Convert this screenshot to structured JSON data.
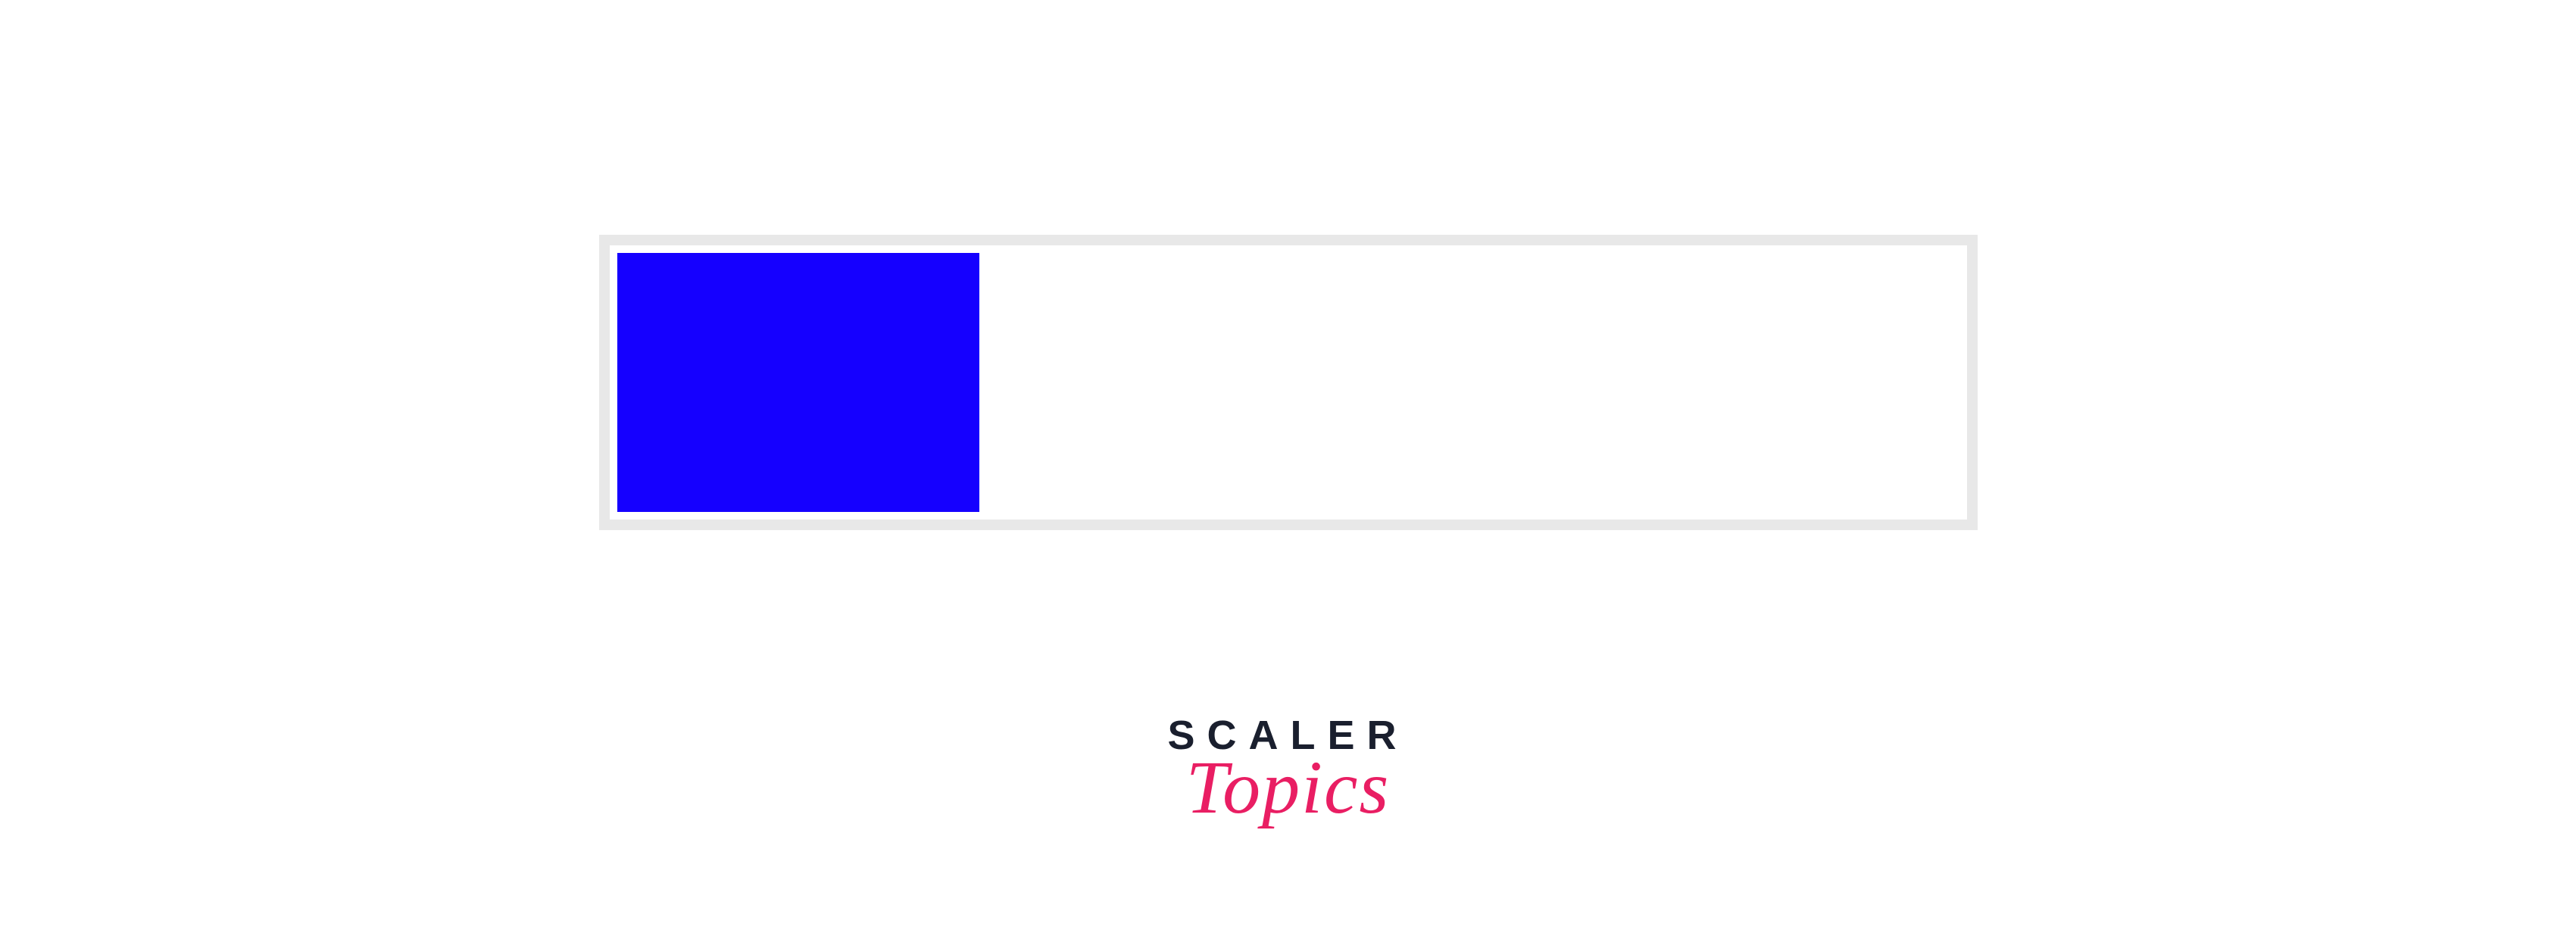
{
  "progress": {
    "percent": 27,
    "fill_color": "#1500ff",
    "track_color": "#e8e8e8"
  },
  "logo": {
    "line1": "SCALER",
    "line2": "Topics",
    "line1_color": "#1a1f2e",
    "line2_color": "#e91e63"
  }
}
